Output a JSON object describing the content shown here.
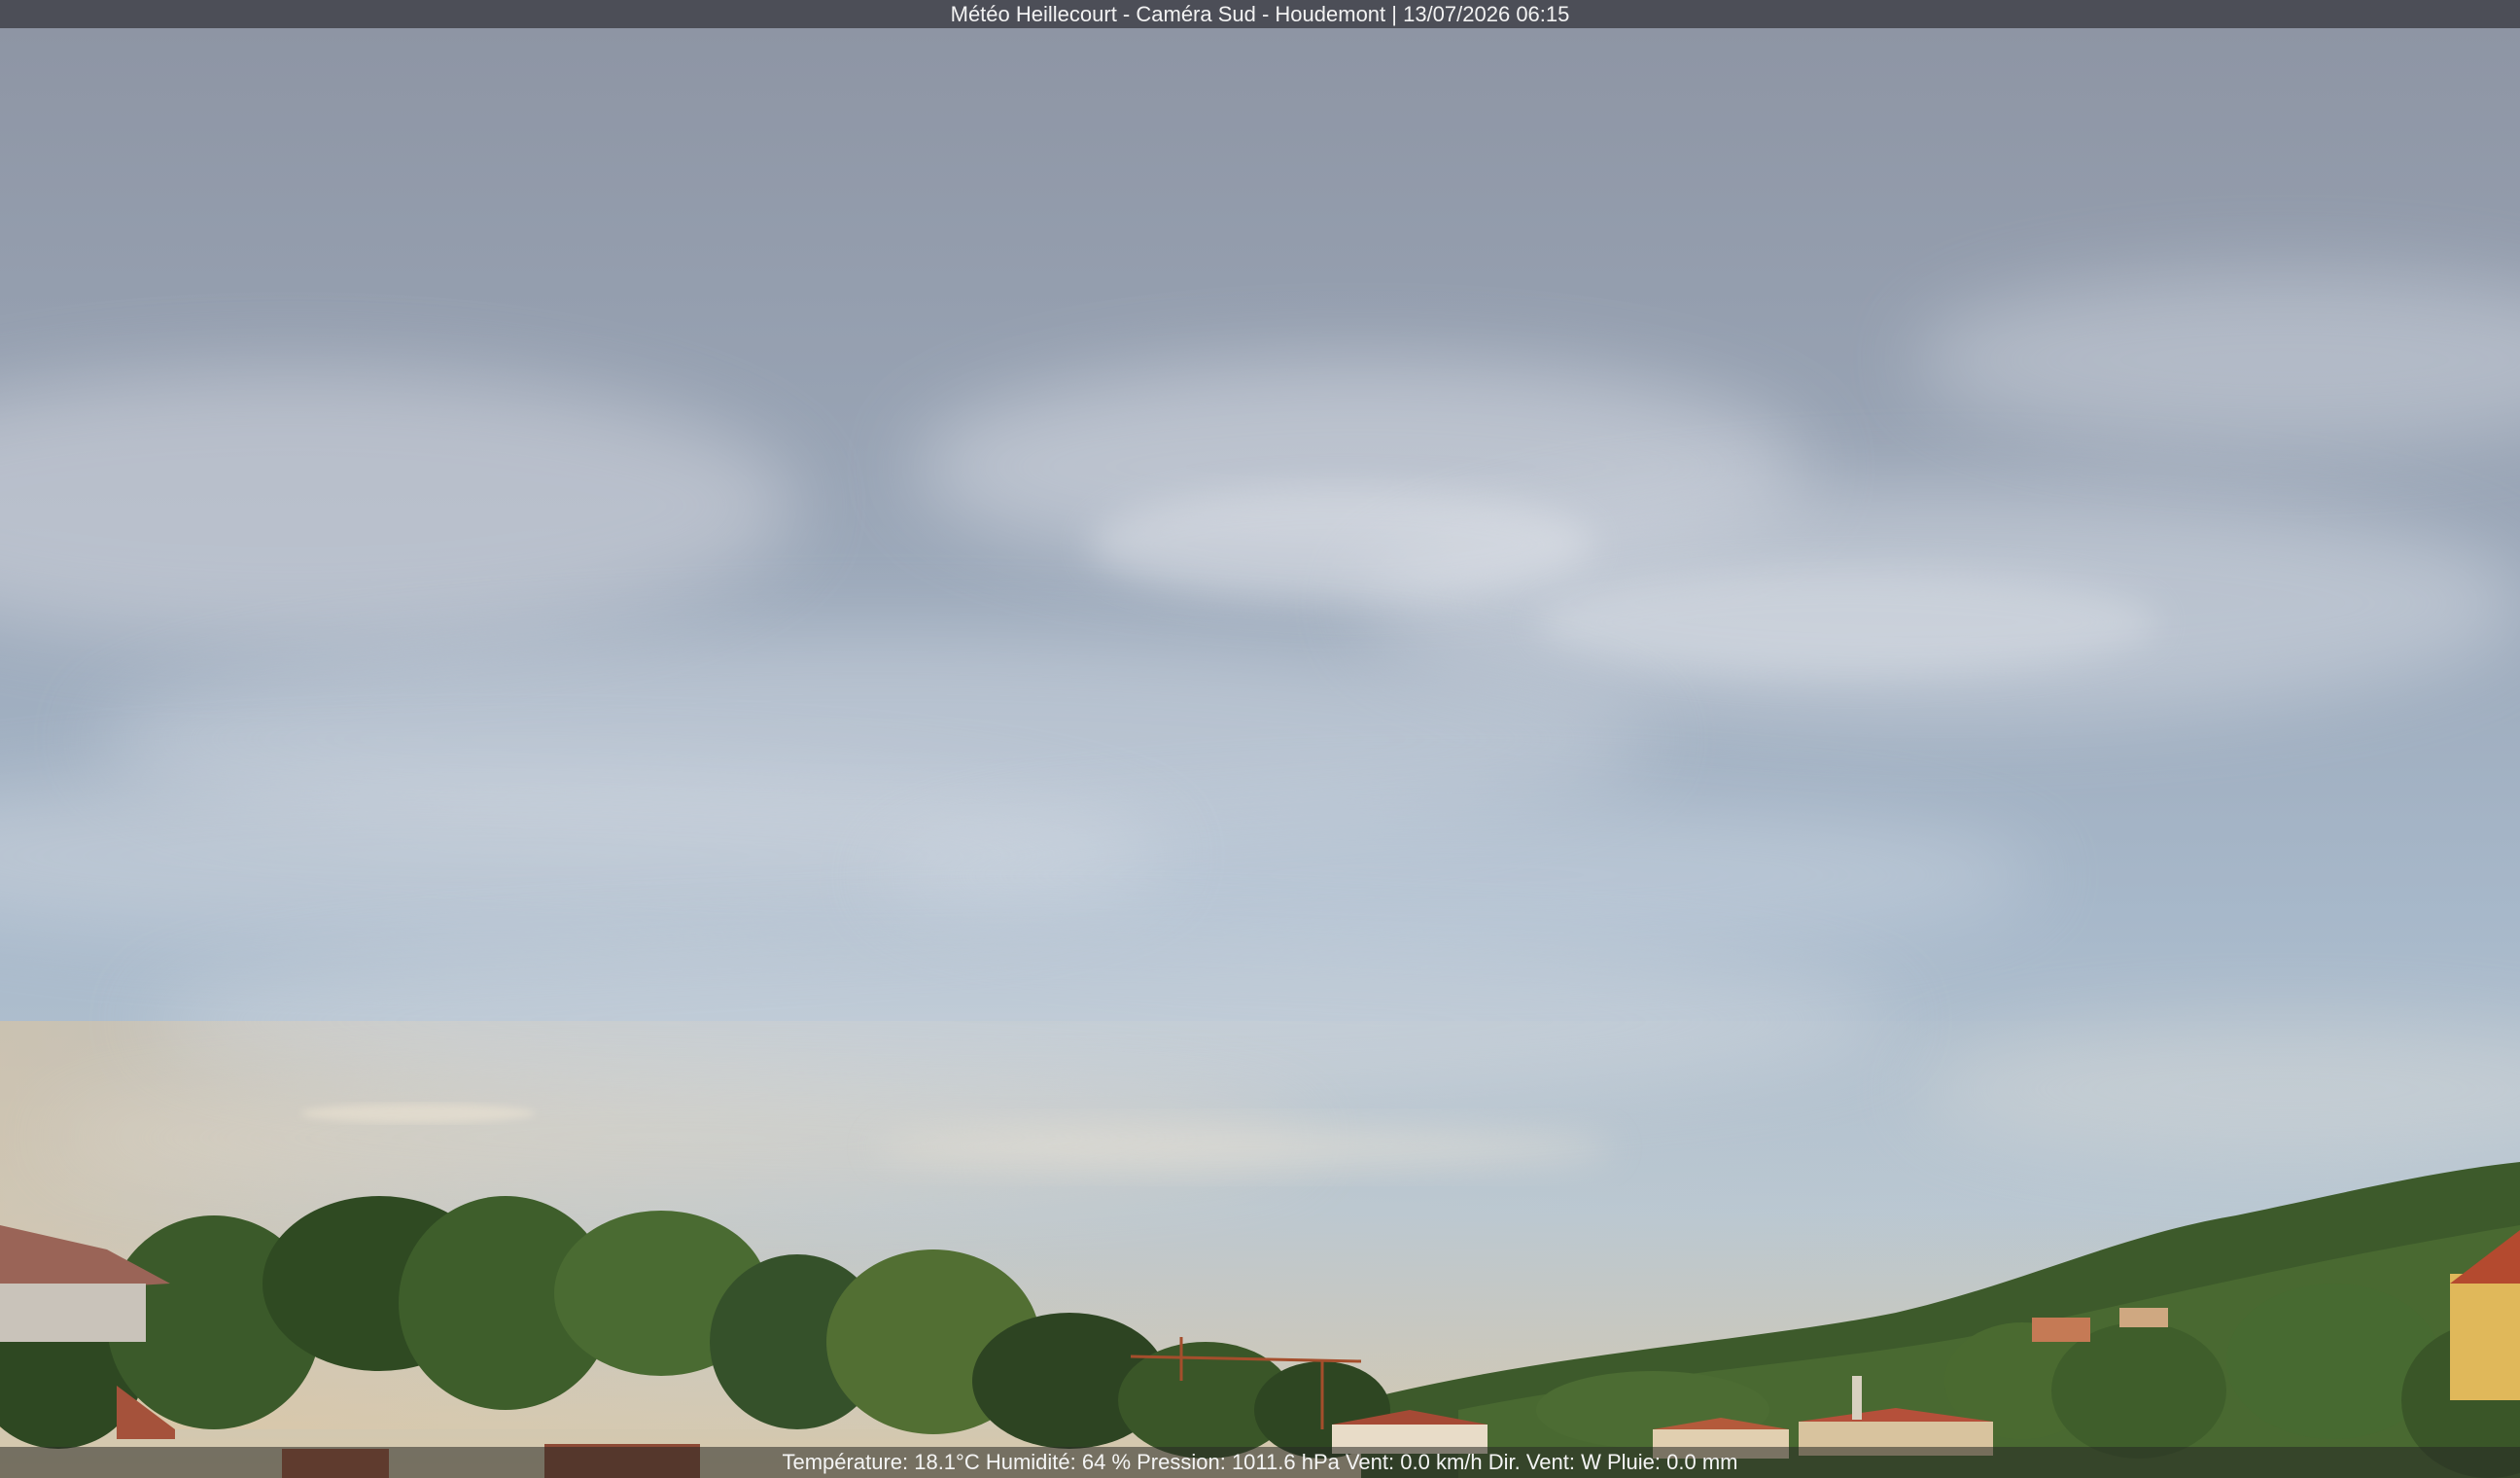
{
  "overlay": {
    "title": "Météo Heillecourt - Caméra Sud - Houdemont | 13/07/2026 06:15",
    "weather_line": "Température: 18.1°C  Humidité: 64 % Pression: 1011.6 hPa Vent: 0.0 km/h Dir. Vent: W Pluie: 0.0 mm"
  },
  "scene": {
    "sky_top_color": "#8f97a6",
    "sky_mid_color": "#a9b8c9",
    "sky_horizon_color": "#d7c6a8",
    "foliage_color": "#2f4a22",
    "roof_color": "#a5523b"
  }
}
